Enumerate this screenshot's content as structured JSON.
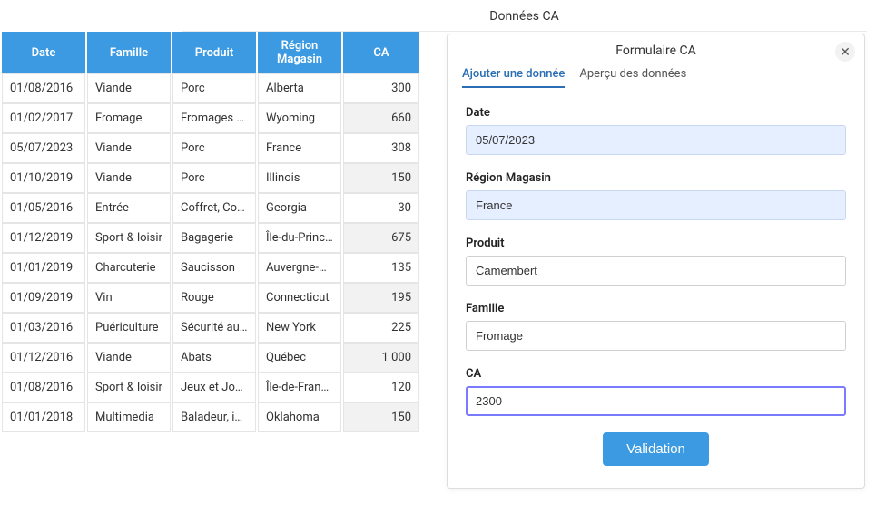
{
  "pageTitle": "Données CA",
  "table": {
    "headers": [
      "Date",
      "Famille",
      "Produit",
      "Région Magasin",
      "CA"
    ],
    "rows": [
      {
        "date": "01/08/2016",
        "famille": "Viande",
        "produit": "Porc",
        "region": "Alberta",
        "ca": "300"
      },
      {
        "date": "01/02/2017",
        "famille": "Fromage",
        "produit": "Fromages de...",
        "region": "Wyoming",
        "ca": "660"
      },
      {
        "date": "05/07/2023",
        "famille": "Viande",
        "produit": "Porc",
        "region": "France",
        "ca": "308"
      },
      {
        "date": "01/10/2019",
        "famille": "Viande",
        "produit": "Porc",
        "region": "Illinois",
        "ca": "150"
      },
      {
        "date": "01/05/2016",
        "famille": "Entrée",
        "produit": "Coffret, Corb...",
        "region": "Georgia",
        "ca": "30"
      },
      {
        "date": "01/12/2019",
        "famille": "Sport & loisir",
        "produit": "Bagagerie",
        "region": "Île-du-Prince...",
        "ca": "675"
      },
      {
        "date": "01/01/2019",
        "famille": "Charcuterie",
        "produit": "Saucisson",
        "region": "Auvergne-Rh...",
        "ca": "135"
      },
      {
        "date": "01/09/2019",
        "famille": "Vin",
        "produit": "Rouge",
        "region": "Connecticut",
        "ca": "195"
      },
      {
        "date": "01/03/2016",
        "famille": "Puériculture",
        "produit": "Sécurité auto",
        "region": "New York",
        "ca": "225"
      },
      {
        "date": "01/12/2016",
        "famille": "Viande",
        "produit": "Abats",
        "region": "Québec",
        "ca": "1 000"
      },
      {
        "date": "01/08/2016",
        "famille": "Sport & loisir",
        "produit": "Jeux et Jouet",
        "region": "Île-de-France",
        "ca": "120"
      },
      {
        "date": "01/01/2018",
        "famille": "Multimedia",
        "produit": "Baladeur, iPod",
        "region": "Oklahoma",
        "ca": "150"
      }
    ]
  },
  "panel": {
    "title": "Formulaire CA",
    "tabs": {
      "add": "Ajouter une donnée",
      "preview": "Aperçu des données"
    },
    "fields": {
      "dateLabel": "Date",
      "dateValue": "05/07/2023",
      "regionLabel": "Région Magasin",
      "regionValue": "France",
      "produitLabel": "Produit",
      "produitValue": "Camembert",
      "familleLabel": "Famille",
      "familleValue": "Fromage",
      "caLabel": "CA",
      "caValue": "2300"
    },
    "validateLabel": "Validation"
  }
}
